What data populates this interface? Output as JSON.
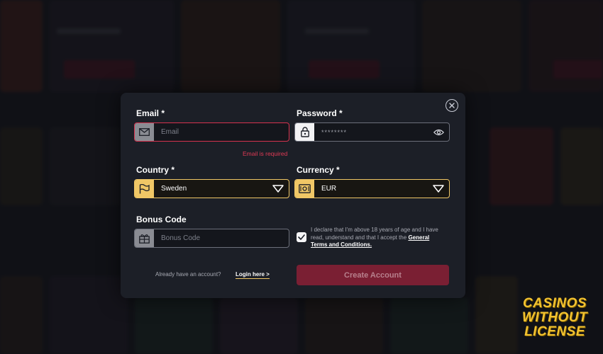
{
  "form": {
    "email": {
      "label": "Email *",
      "placeholder": "Email",
      "error": "Email is required"
    },
    "password": {
      "label": "Password *",
      "value": "********"
    },
    "country": {
      "label": "Country *",
      "selected": "Sweden"
    },
    "currency": {
      "label": "Currency *",
      "selected": "EUR"
    },
    "bonus": {
      "label": "Bonus Code",
      "placeholder": "Bonus Code"
    },
    "declaration": {
      "text": "I declare that I'm above 18 years of age and I have read, understand and that I accept the",
      "link": "General Terms and Conditions.",
      "checked": true
    },
    "footer": {
      "already_text": "Already have an account?",
      "login_link": "Login here >",
      "create_button": "Create Account"
    }
  },
  "brand": {
    "line1": "CASINOS",
    "line2": "WITHOUT",
    "line3": "LICENSE"
  },
  "colors": {
    "accent_gold": "#f0c766",
    "error_red": "#d6334e",
    "button_bg": "#7a1f33",
    "modal_bg": "#1c1f27"
  },
  "icons": {
    "email": "envelope-icon",
    "password": "lock-icon",
    "visibility": "eye-icon",
    "country": "flag-icon",
    "currency": "money-icon",
    "bonus": "gift-icon",
    "dropdown": "triangle-down-icon",
    "close": "close-icon",
    "check": "check-icon"
  }
}
